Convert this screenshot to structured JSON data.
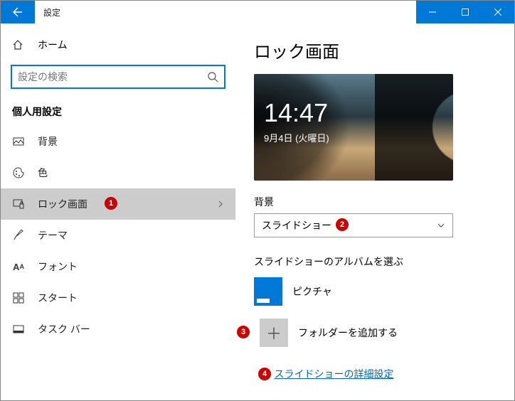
{
  "titlebar": {
    "title": "設定"
  },
  "sidebar": {
    "home": "ホーム",
    "search_placeholder": "設定の検索",
    "section": "個人用設定",
    "items": [
      {
        "label": "背景"
      },
      {
        "label": "色"
      },
      {
        "label": "ロック画面",
        "selected": true,
        "badge": "1"
      },
      {
        "label": "テーマ"
      },
      {
        "label": "フォント"
      },
      {
        "label": "スタート"
      },
      {
        "label": "タスク バー"
      }
    ]
  },
  "content": {
    "title": "ロック画面",
    "preview": {
      "time": "14:47",
      "date": "9月4日 (火曜日)"
    },
    "bg_label": "背景",
    "bg_value": "スライドショー",
    "bg_badge": "2",
    "album_label": "スライドショーのアルバムを選ぶ",
    "album_name": "ピクチャ",
    "add_folder": "フォルダーを追加する",
    "add_badge": "3",
    "advanced_link": "スライドショーの詳細設定",
    "advanced_badge": "4"
  }
}
